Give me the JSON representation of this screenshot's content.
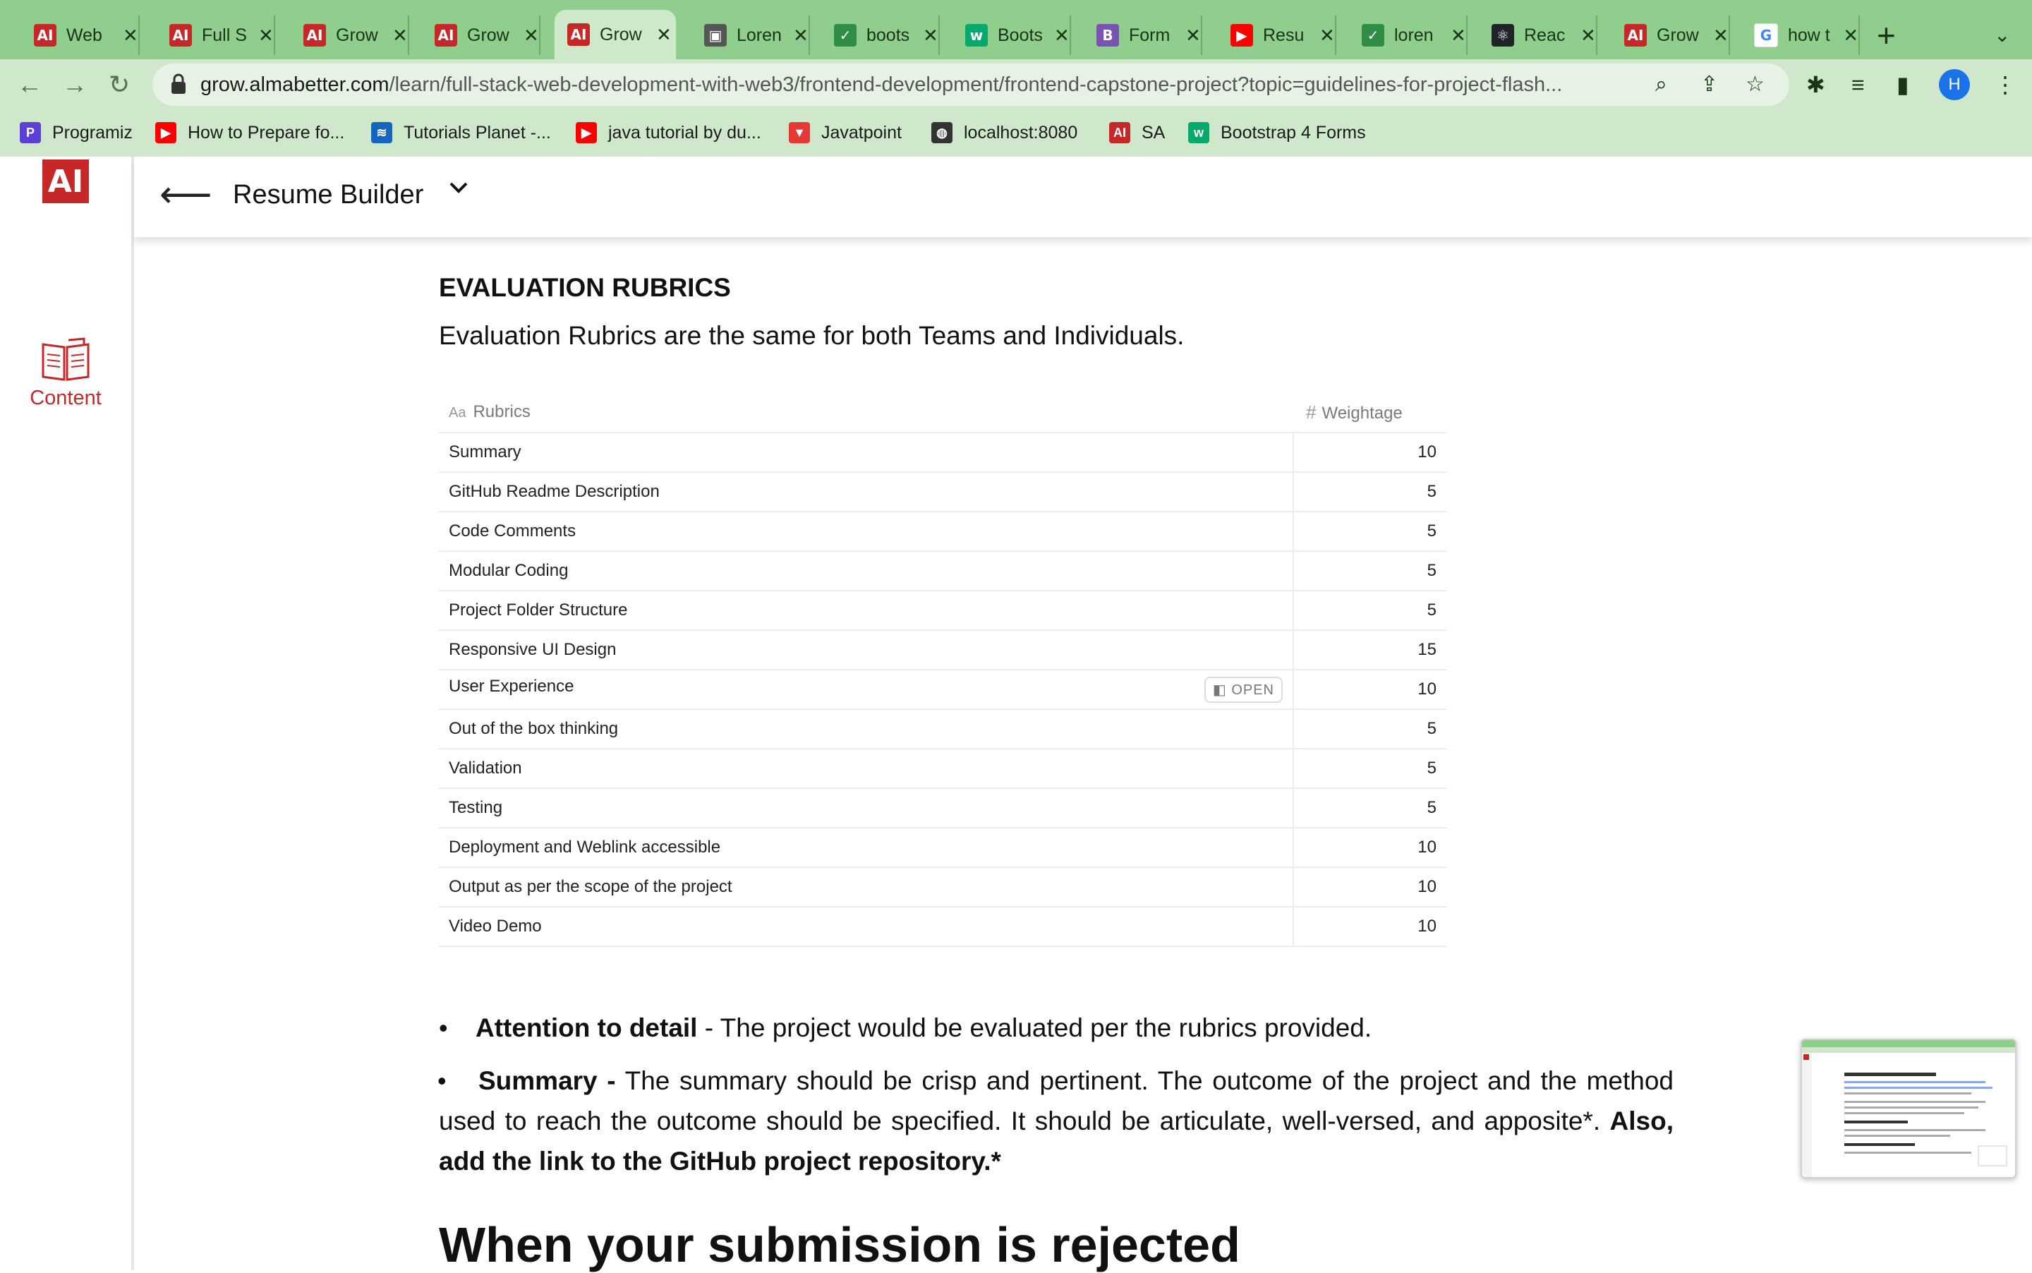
{
  "browser": {
    "tabs": [
      {
        "title": "Web",
        "favicon": "almabetter-icon",
        "active": false
      },
      {
        "title": "Full S",
        "favicon": "almabetter-icon",
        "active": false
      },
      {
        "title": "Grow",
        "favicon": "almabetter-icon",
        "active": false
      },
      {
        "title": "Grow",
        "favicon": "almabetter-icon",
        "active": false
      },
      {
        "title": "Grow",
        "favicon": "almabetter-icon",
        "active": true
      },
      {
        "title": "Loren",
        "favicon": "image-icon",
        "active": false
      },
      {
        "title": "boots",
        "favicon": "geeks-icon",
        "active": false
      },
      {
        "title": "Boots",
        "favicon": "w3-icon",
        "active": false
      },
      {
        "title": "Form",
        "favicon": "bootstrap-icon",
        "active": false
      },
      {
        "title": "Resu",
        "favicon": "youtube-icon",
        "active": false
      },
      {
        "title": "loren",
        "favicon": "geeks-icon",
        "active": false
      },
      {
        "title": "Reac",
        "favicon": "react-icon",
        "active": false
      },
      {
        "title": "Grow",
        "favicon": "almabetter-icon",
        "active": false
      },
      {
        "title": "how t",
        "favicon": "google-icon",
        "active": false
      }
    ],
    "url_host": "grow.almabetter.com",
    "url_path": "/learn/full-stack-web-development-with-web3/frontend-development/frontend-capstone-project?topic=guidelines-for-project-flash...",
    "profile_initial": "H",
    "bookmarks": [
      {
        "label": "Programiz",
        "icon": "programiz-icon"
      },
      {
        "label": "How to Prepare fo...",
        "icon": "youtube-icon"
      },
      {
        "label": "Tutorials Planet -...",
        "icon": "tutorials-icon"
      },
      {
        "label": "java tutorial by du...",
        "icon": "youtube-icon"
      },
      {
        "label": "Javatpoint",
        "icon": "javatpoint-icon"
      },
      {
        "label": "localhost:8080",
        "icon": "globe-icon"
      },
      {
        "label": "SA",
        "icon": "almabetter-icon"
      },
      {
        "label": "Bootstrap 4 Forms",
        "icon": "w3-icon"
      }
    ]
  },
  "app": {
    "logo_text": "AI",
    "sidebar_content_label": "Content",
    "project_title": "Resume Builder"
  },
  "article": {
    "heading": "EVALUATION RUBRICS",
    "intro": "Evaluation Rubrics are the same for both Teams and Individuals.",
    "table": {
      "col_rubrics": "Rubrics",
      "col_weightage": "Weightage",
      "open_label": "OPEN",
      "rows": [
        {
          "rubric": "Summary",
          "weight": "10"
        },
        {
          "rubric": "GitHub Readme Description",
          "weight": "5"
        },
        {
          "rubric": "Code Comments",
          "weight": "5"
        },
        {
          "rubric": "Modular Coding",
          "weight": "5"
        },
        {
          "rubric": "Project Folder Structure",
          "weight": "5"
        },
        {
          "rubric": "Responsive UI Design",
          "weight": "15"
        },
        {
          "rubric": "User Experience",
          "weight": "10"
        },
        {
          "rubric": "Out of the box thinking",
          "weight": "5"
        },
        {
          "rubric": "Validation",
          "weight": "5"
        },
        {
          "rubric": "Testing",
          "weight": "5"
        },
        {
          "rubric": "Deployment and Weblink accessible",
          "weight": "10"
        },
        {
          "rubric": "Output as per the scope of the project",
          "weight": "10"
        },
        {
          "rubric": "Video Demo",
          "weight": "10"
        }
      ]
    },
    "bullet1_bold": "Attention to detail",
    "bullet1_text": " - The project would be evaluated per the rubrics provided.",
    "bullet2_bold": "Summary -",
    "bullet2_text": " The summary should be crisp and pertinent. The outcome of the project and the method used to reach the outcome should be specified. It should be articulate, well-versed, and apposite*. ",
    "bullet2_bold2": "Also, add the link to the GitHub project repository.*",
    "section_heading": "When your submission is rejected"
  },
  "colors": {
    "browser_frame": "#8fce8c",
    "toolbar": "#cfe8cc",
    "brand_red": "#c62828",
    "profile_blue": "#1a73e8"
  }
}
